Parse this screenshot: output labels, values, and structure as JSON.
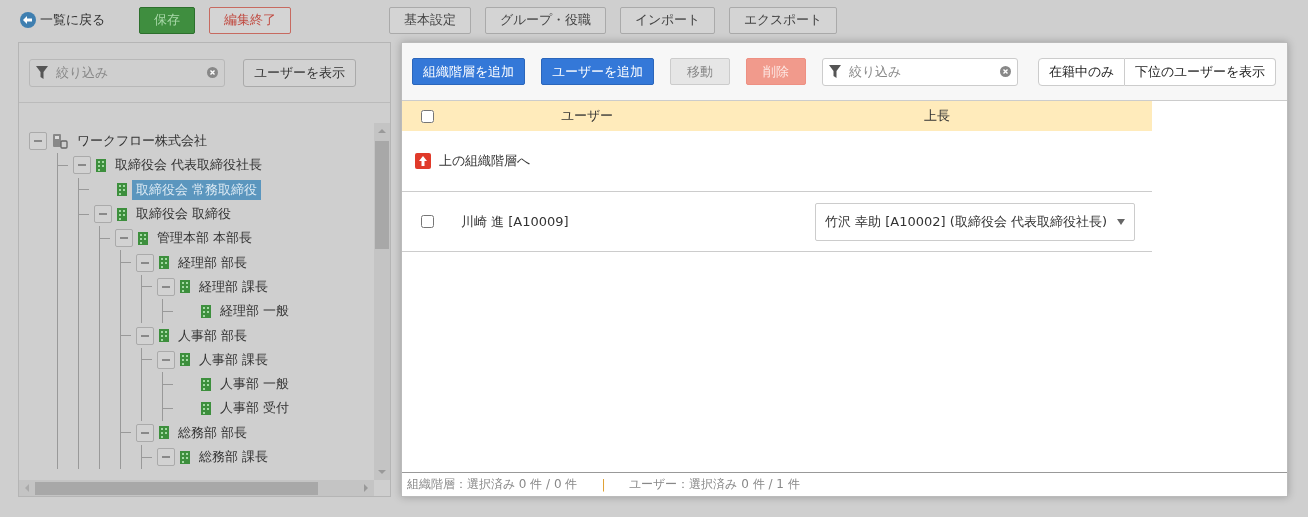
{
  "header": {
    "back_link": "一覧に戻る",
    "buttons": [
      {
        "label": "保存",
        "kind": "save"
      },
      {
        "label": "編集終了",
        "kind": "cancel"
      }
    ],
    "tabs": [
      {
        "label": "基本設定"
      },
      {
        "label": "グループ・役職"
      },
      {
        "label": "インポート"
      },
      {
        "label": "エクスポート"
      }
    ]
  },
  "left_panel": {
    "filter": {
      "placeholder": "絞り込み"
    },
    "show_users_button": "ユーザーを表示",
    "tree": [
      {
        "label": "ワークフロー株式会社",
        "kind": "company",
        "expanded": true,
        "selected": false,
        "children": [
          {
            "label": "取締役会 代表取締役社長",
            "kind": "post",
            "expanded": true,
            "selected": false,
            "children": [
              {
                "label": "取締役会 常務取締役",
                "kind": "post",
                "selected": true
              },
              {
                "label": "取締役会 取締役",
                "kind": "post",
                "expanded": true,
                "selected": false,
                "children": [
                  {
                    "label": "管理本部 本部長",
                    "kind": "post",
                    "expanded": true,
                    "selected": false,
                    "children": [
                      {
                        "label": "経理部 部長",
                        "kind": "post",
                        "expanded": true,
                        "selected": false,
                        "children": [
                          {
                            "label": "経理部 課長",
                            "kind": "post",
                            "expanded": true,
                            "selected": false,
                            "children": [
                              {
                                "label": "経理部 一般",
                                "kind": "post",
                                "selected": false
                              }
                            ]
                          }
                        ]
                      },
                      {
                        "label": "人事部 部長",
                        "kind": "post",
                        "expanded": true,
                        "selected": false,
                        "children": [
                          {
                            "label": "人事部 課長",
                            "kind": "post",
                            "expanded": true,
                            "selected": false,
                            "children": [
                              {
                                "label": "人事部 一般",
                                "kind": "post",
                                "selected": false
                              },
                              {
                                "label": "人事部 受付",
                                "kind": "post",
                                "selected": false
                              }
                            ]
                          }
                        ]
                      },
                      {
                        "label": "総務部 部長",
                        "kind": "post",
                        "expanded": true,
                        "selected": false,
                        "children": [
                          {
                            "label": "総務部 課長",
                            "kind": "post",
                            "expanded": true,
                            "selected": false
                          }
                        ]
                      }
                    ]
                  }
                ]
              }
            ]
          }
        ]
      }
    ]
  },
  "right_panel": {
    "toolbar": [
      {
        "label": "組織階層を追加",
        "kind": "primary"
      },
      {
        "label": "ユーザーを追加",
        "kind": "primary"
      },
      {
        "label": "移動",
        "kind": "disabled"
      },
      {
        "label": "削除",
        "kind": "danger"
      }
    ],
    "filter": {
      "placeholder": "絞り込み"
    },
    "toggles": [
      {
        "label": "在籍中のみ",
        "selected": false
      },
      {
        "label": "下位のユーザーを表示",
        "selected": false
      }
    ],
    "table": {
      "columns": [
        "ユーザー",
        "上長"
      ],
      "header_checked": false,
      "up_link": "上の組織階層へ",
      "rows": [
        {
          "checked": false,
          "user": "川崎 進 [A10009]",
          "manager": "竹沢 幸助 [A10002] (取締役会 代表取締役社長)"
        }
      ]
    },
    "status_bar": {
      "groups": "組織階層：選択済み 0 件 / 0 件",
      "separator": "|",
      "users": "ユーザー：選択済み 0 件 / 1 件"
    }
  }
}
